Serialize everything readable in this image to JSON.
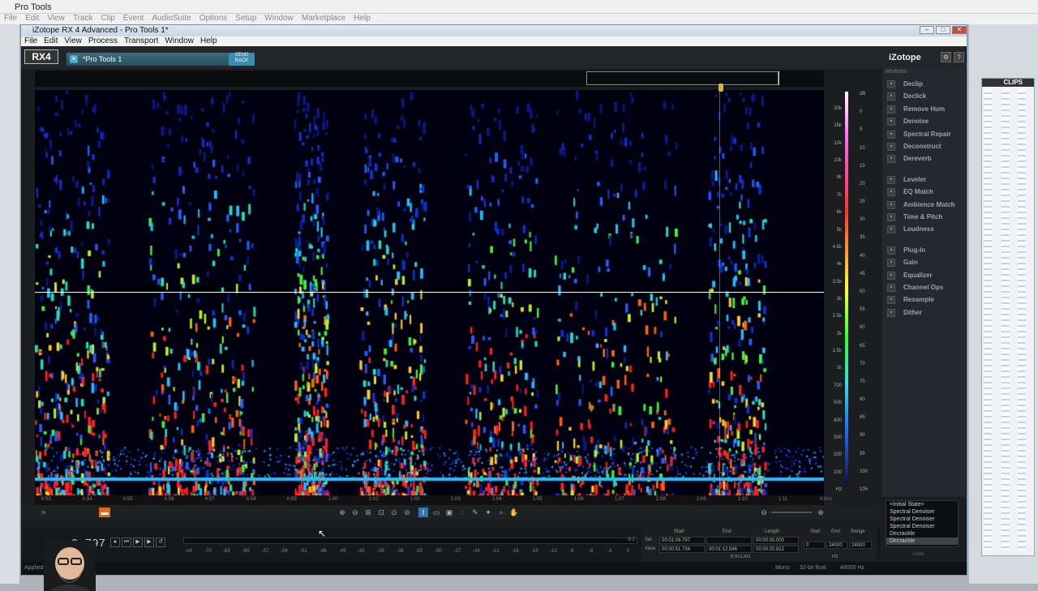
{
  "pt": {
    "title": "Pro Tools",
    "menu": [
      "File",
      "Edit",
      "View",
      "Track",
      "Clip",
      "Event",
      "AudioSuite",
      "Options",
      "Setup",
      "Window",
      "Marketplace",
      "Help"
    ],
    "clips_label": "CLIPS"
  },
  "rx": {
    "title": "iZotope RX 4 Advanced - Pro Tools 1*",
    "menu": [
      "File",
      "Edit",
      "View",
      "Process",
      "Transport",
      "Window",
      "Help"
    ],
    "logo": "RX4",
    "tab_label": "*Pro Tools 1",
    "send_back": "SEND BACK",
    "brand": "iZotope"
  },
  "freq_labels": [
    "20k",
    "15k",
    "12k",
    "10k",
    "8k",
    "7k",
    "6k",
    "5k",
    "4.5k",
    "4k",
    "3.5k",
    "3k",
    "2.5k",
    "2k",
    "1.5k",
    "1k",
    "700",
    "500",
    "400",
    "300",
    "200",
    "100",
    "Hz"
  ],
  "db_labels": [
    "dB",
    "0",
    "5",
    "10",
    "15",
    "20",
    "25",
    "30",
    "35",
    "40",
    "45",
    "50",
    "55",
    "60",
    "65",
    "70",
    "75",
    "80",
    "85",
    "90",
    "95",
    "100",
    "105"
  ],
  "time_labels": [
    "h:53",
    "h:54",
    "h:55",
    "h:56",
    "h:57",
    "h:58",
    "h:59",
    "1:00",
    "1:01",
    "1:02",
    "1:03",
    "1:04",
    "1:05",
    "1:06",
    "1:07",
    "1:08",
    "1:09",
    "1:10",
    "1:11",
    "h:m:s"
  ],
  "transport": {
    "time": "9.797",
    "meter_labels": [
      "-Inf.",
      "-70",
      "-63",
      "-60",
      "-57",
      "-54",
      "-51",
      "-48",
      "-45",
      "-42",
      "-39",
      "-36",
      "-33",
      "-30",
      "-27",
      "-24",
      "-21",
      "-18",
      "-15",
      "-12",
      "-9",
      "-6",
      "-3",
      "0"
    ],
    "meter_end": "-9.2"
  },
  "selection": {
    "headers": {
      "start": "Start",
      "end": "End",
      "length": "Length",
      "range_start": "Start",
      "range_end": "End",
      "range": "Range"
    },
    "sel_label": "Sel",
    "view_label": "View",
    "sel": {
      "start": "00:01:09.797",
      "end": "",
      "length": "00:00:00.000"
    },
    "view": {
      "start": "00:00:51.734",
      "end": "00:01:12.546",
      "length": "00:00:20.812"
    },
    "hz": {
      "start": "0",
      "end": "24000",
      "range": "24000"
    },
    "time_unit": "h:m:s.ms",
    "hz_unit": "Hz"
  },
  "status": {
    "left": "Applied Decrackle (655 ms)",
    "items": [
      "Mono",
      "32-bit float",
      "48000 Hz"
    ]
  },
  "modules": {
    "heading": "Modules",
    "items": [
      {
        "label": "Declip",
        "icon": "declip-icon"
      },
      {
        "label": "Declick",
        "icon": "declick-icon"
      },
      {
        "label": "Remove Hum",
        "icon": "hum-icon"
      },
      {
        "label": "Denoise",
        "icon": "denoise-icon"
      },
      {
        "label": "Spectral Repair",
        "icon": "spectral-icon"
      },
      {
        "label": "Deconstruct",
        "icon": "deconstruct-icon"
      },
      {
        "label": "Dereverb",
        "icon": "dereverb-icon"
      },
      {
        "label": "Leveler",
        "icon": "leveler-icon"
      },
      {
        "label": "EQ Match",
        "icon": "eq-match-icon"
      },
      {
        "label": "Ambience Match",
        "icon": "ambience-icon"
      },
      {
        "label": "Time & Pitch",
        "icon": "time-pitch-icon"
      },
      {
        "label": "Loudness",
        "icon": "loudness-icon"
      },
      {
        "label": "Plug-In",
        "icon": "plugin-icon"
      },
      {
        "label": "Gain",
        "icon": "gain-icon"
      },
      {
        "label": "Equalizer",
        "icon": "equalizer-icon"
      },
      {
        "label": "Channel Ops",
        "icon": "channel-ops-icon"
      },
      {
        "label": "Resample",
        "icon": "resample-icon"
      },
      {
        "label": "Dither",
        "icon": "dither-icon"
      }
    ]
  },
  "history": {
    "items": [
      "<Initial State>",
      "Spectral Denoiser",
      "Spectral Denoiser",
      "Spectral Denoiser",
      "Decrackle",
      "Decrackle"
    ],
    "selected_index": 5,
    "undo_label": "Undo"
  },
  "colors": {
    "accent": "#2f78b7",
    "tab": "#3a6f80",
    "playhead_marker": "#d6b43c"
  }
}
